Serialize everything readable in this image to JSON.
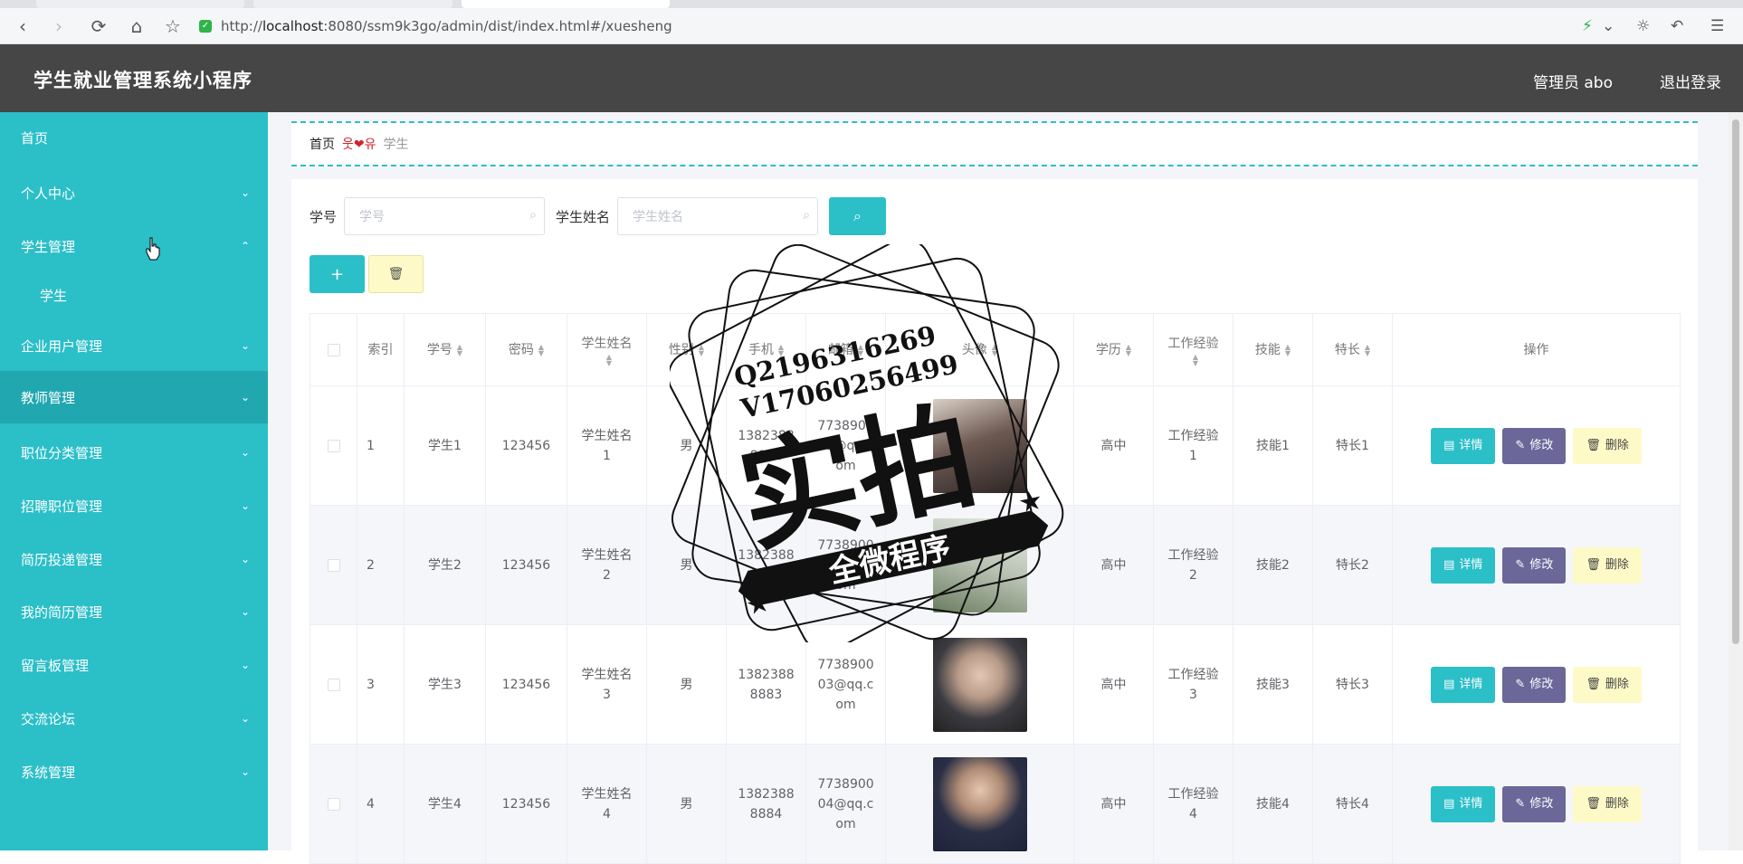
{
  "browser": {
    "url_prefix": "http://",
    "url_host": "localhost",
    "url_rest": ":8080/ssm9k3go/admin/dist/index.html#/xuesheng"
  },
  "header": {
    "title": "学生就业管理系统小程序",
    "admin": "管理员 abo",
    "logout": "退出登录"
  },
  "sidebar": {
    "items": [
      {
        "label": "首页",
        "chevron": ""
      },
      {
        "label": "个人中心",
        "chevron": "⌄"
      },
      {
        "label": "学生管理",
        "chevron": "⌃"
      },
      {
        "label": "学生",
        "chevron": ""
      },
      {
        "label": "企业用户管理",
        "chevron": "⌄"
      },
      {
        "label": "教师管理",
        "chevron": "⌄"
      },
      {
        "label": "职位分类管理",
        "chevron": "⌄"
      },
      {
        "label": "招聘职位管理",
        "chevron": "⌄"
      },
      {
        "label": "简历投递管理",
        "chevron": "⌄"
      },
      {
        "label": "我的简历管理",
        "chevron": "⌄"
      },
      {
        "label": "留言板管理",
        "chevron": "⌄"
      },
      {
        "label": "交流论坛",
        "chevron": "⌄"
      },
      {
        "label": "系统管理",
        "chevron": "⌄"
      }
    ]
  },
  "breadcrumb": {
    "home": "首页",
    "separator": "웃❤유",
    "current": "学生"
  },
  "search": {
    "label1": "学号",
    "placeholder1": "学号",
    "label2": "学生姓名",
    "placeholder2": "学生姓名",
    "button_icon": "search-icon"
  },
  "actions": {
    "add_icon": "plus-icon",
    "delete_icon": "trash-icon"
  },
  "table": {
    "headers": [
      "索引",
      "学号",
      "密码",
      "学生姓名",
      "性别",
      "手机",
      "邮箱",
      "头像",
      "学历",
      "工作经验",
      "技能",
      "特长",
      "操作"
    ],
    "rows": [
      {
        "idx": "1",
        "xuehao": "学生1",
        "mima": "123456",
        "name": "学生姓名1",
        "sex": "男",
        "phone": "13823888881",
        "email": "773890001@qq.com",
        "edu": "高中",
        "exp": "工作经验1",
        "skill": "技能1",
        "special": "特长1"
      },
      {
        "idx": "2",
        "xuehao": "学生2",
        "mima": "123456",
        "name": "学生姓名2",
        "sex": "男",
        "phone": "13823888882",
        "email": "773890002@qq.com",
        "edu": "高中",
        "exp": "工作经验2",
        "skill": "技能2",
        "special": "特长2"
      },
      {
        "idx": "3",
        "xuehao": "学生3",
        "mima": "123456",
        "name": "学生姓名3",
        "sex": "男",
        "phone": "13823888883",
        "email": "773890003@qq.com",
        "edu": "高中",
        "exp": "工作经验3",
        "skill": "技能3",
        "special": "特长3"
      },
      {
        "idx": "4",
        "xuehao": "学生4",
        "mima": "123456",
        "name": "学生姓名4",
        "sex": "男",
        "phone": "13823888884",
        "email": "773890004@qq.com",
        "edu": "高中",
        "exp": "工作经验4",
        "skill": "技能4",
        "special": "特长4"
      }
    ],
    "btn_detail": "详情",
    "btn_edit": "修改",
    "btn_delete": "删除"
  },
  "watermark": {
    "line1": "Q2196316269",
    "line2": "V17060256499",
    "big": "实拍",
    "banner": "全微程序"
  },
  "colors": {
    "accent": "#2bbfc8",
    "header_bg": "#464646",
    "edit": "#6b6799",
    "delete": "#fdfac7"
  }
}
